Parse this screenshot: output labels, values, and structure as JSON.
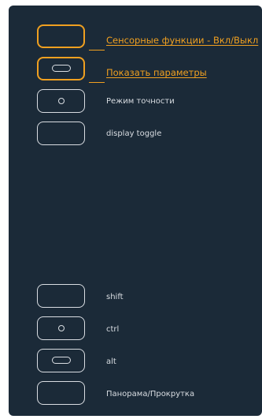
{
  "colors": {
    "panel_background": "#1b2a38",
    "key_outline": "#d9dde2",
    "highlight": "#f0a020",
    "label_text": "#d9dde2"
  },
  "keys": [
    {
      "id": "touch-toggle",
      "icon": "none",
      "highlighted": true,
      "label": "Сенсорные функции - Вкл/Выкл"
    },
    {
      "id": "show-settings",
      "icon": "pill-icon",
      "highlighted": true,
      "label": "Показать параметры"
    },
    {
      "id": "precision-mode",
      "icon": "dot-icon",
      "highlighted": false,
      "label": "Режим точности"
    },
    {
      "id": "display-toggle",
      "icon": "none",
      "highlighted": false,
      "label": "display toggle"
    },
    {
      "id": "shift",
      "icon": "none",
      "highlighted": false,
      "label": "shift"
    },
    {
      "id": "ctrl",
      "icon": "dot-icon",
      "highlighted": false,
      "label": "ctrl"
    },
    {
      "id": "alt",
      "icon": "pill-icon",
      "highlighted": false,
      "label": "alt"
    },
    {
      "id": "pan-scroll",
      "icon": "none",
      "highlighted": false,
      "label": "Панорама/Прокрутка"
    }
  ]
}
